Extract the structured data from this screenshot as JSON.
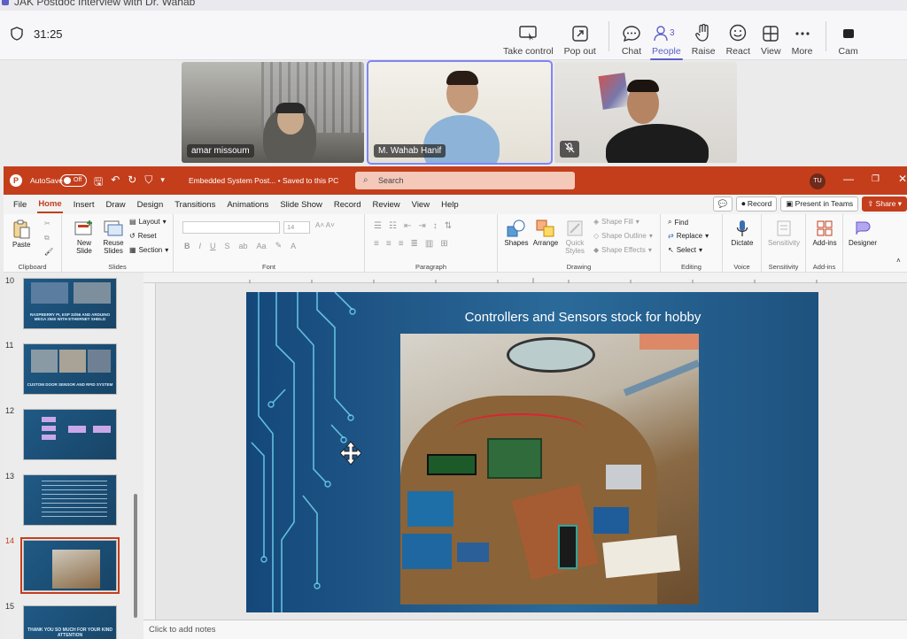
{
  "teams": {
    "window_title": "JAK Postdoc Interview with Dr. Wahab",
    "timer": "31:25",
    "actions": [
      {
        "label": "Take control"
      },
      {
        "label": "Pop out"
      },
      {
        "label": "Chat"
      },
      {
        "label": "People",
        "badge": "3"
      },
      {
        "label": "Raise"
      },
      {
        "label": "React"
      },
      {
        "label": "View"
      },
      {
        "label": "More"
      },
      {
        "label": "Cam"
      }
    ],
    "participants": [
      {
        "name": "amar missoum"
      },
      {
        "name": "M. Wahab Hanif"
      },
      {
        "name": ""
      }
    ],
    "accent": "#5b5fc7"
  },
  "ppt": {
    "accent": "#c43e1c",
    "autosave_label": "AutoSave",
    "autosave_state": "Off",
    "doc_name": "Embedded System Post... • Saved to this PC",
    "search_placeholder": "Search",
    "user_initials": "TU",
    "tabs": [
      "File",
      "Home",
      "Insert",
      "Draw",
      "Design",
      "Transitions",
      "Animations",
      "Slide Show",
      "Record",
      "Review",
      "View",
      "Help"
    ],
    "active_tab": "Home",
    "record_label": "Record",
    "present_label": "Present in Teams",
    "share_label": "Share",
    "ribbon": {
      "clipboard": {
        "label": "Clipboard",
        "paste": "Paste"
      },
      "slides": {
        "label": "Slides",
        "new_slide": "New Slide",
        "reuse": "Reuse Slides",
        "layout": "Layout",
        "reset": "Reset",
        "section": "Section"
      },
      "font": {
        "label": "Font",
        "size": "14"
      },
      "paragraph": {
        "label": "Paragraph"
      },
      "drawing": {
        "label": "Drawing",
        "shapes": "Shapes",
        "arrange": "Arrange",
        "quick_styles": "Quick Styles",
        "fill": "Shape Fill",
        "outline": "Shape Outline",
        "effects": "Shape Effects"
      },
      "editing": {
        "label": "Editing",
        "find": "Find",
        "replace": "Replace",
        "select": "Select"
      },
      "voice": {
        "label": "Voice",
        "dictate": "Dictate"
      },
      "sensitivity": {
        "label": "Sensitivity",
        "btn": "Sensitivity"
      },
      "addins": {
        "label": "Add-ins",
        "btn": "Add-ins"
      },
      "designer": {
        "btn": "Designer"
      }
    },
    "thumbnails": [
      {
        "num": "10",
        "text": "RASPBERRY PI, ESP 32/66 AND ARDUINO MEGA 2560 WITH ETHERNET SHIELD"
      },
      {
        "num": "11",
        "text": "CUSTOM DOOR SENSOR AND RFID SYSTEM"
      },
      {
        "num": "12",
        "text": ""
      },
      {
        "num": "13",
        "text": ""
      },
      {
        "num": "14",
        "text": ""
      },
      {
        "num": "15",
        "text": "THANK YOU SO MUCH FOR YOUR KIND ATTENTION"
      }
    ],
    "slide_title": "Controllers and Sensors stock for hobby",
    "notes_placeholder": "Click to add notes"
  }
}
